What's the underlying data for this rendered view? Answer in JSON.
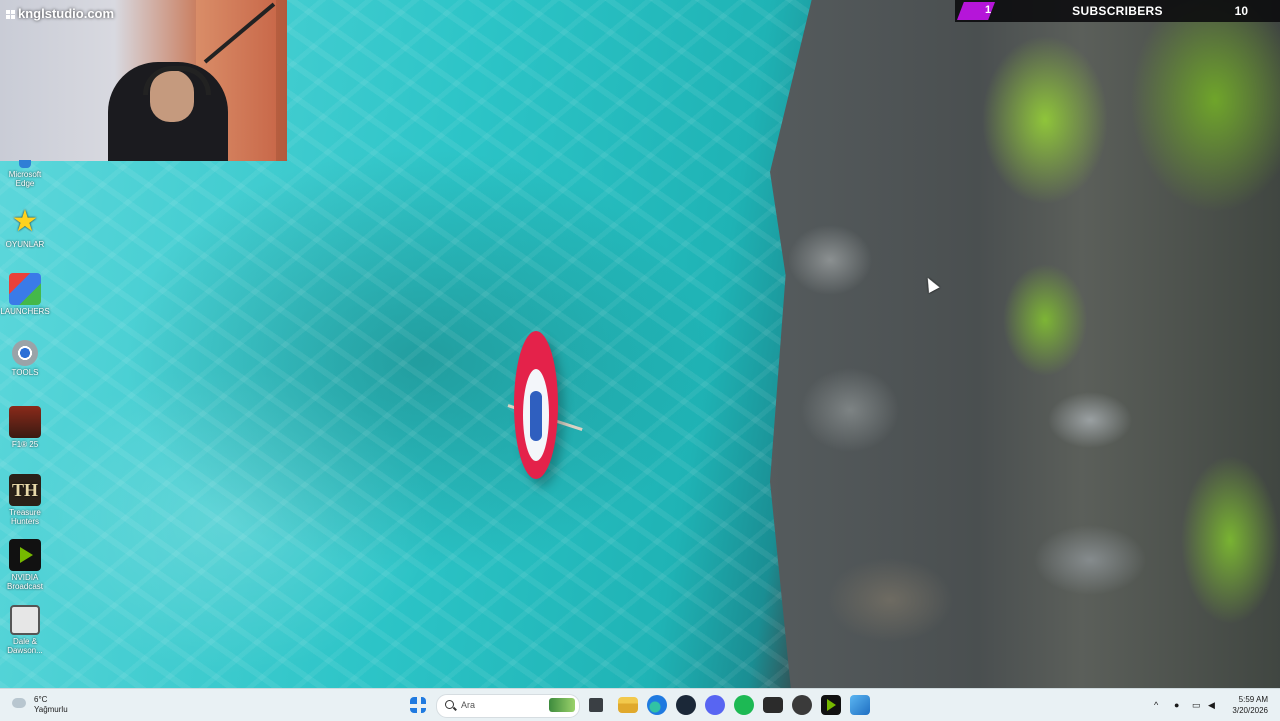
{
  "webcam": {
    "brand": "knglstudio.com"
  },
  "subscriber_goal": {
    "current": "1",
    "label": "SUBSCRIBERS",
    "target": "10",
    "progress_fraction": 0.1,
    "bar_color": "#b515d9"
  },
  "desktop_icons": [
    {
      "label": "Microsoft Edge",
      "icon": "edge-icon"
    },
    {
      "label": "OYUNLAR",
      "icon": "star-folder-icon"
    },
    {
      "label": "LAUNCHERS",
      "icon": "launchers-folder-icon"
    },
    {
      "label": "TOOLS",
      "icon": "tools-gear-icon"
    },
    {
      "label": "F1® 25",
      "icon": "f1-game-icon"
    },
    {
      "label": "Treasure Hunters",
      "icon": "treasure-hunters-icon"
    },
    {
      "label": "NVIDIA Broadcast",
      "icon": "nvidia-broadcast-icon"
    },
    {
      "label": "Dale & Dawson...",
      "icon": "dale-dawson-icon"
    }
  ],
  "taskbar": {
    "weather": {
      "temp": "6°C",
      "condition": "Yağmurlu",
      "icon": "rain-cloud-icon"
    },
    "search_placeholder": "Ara",
    "pinned": [
      {
        "name": "start",
        "icon": "windows-start-icon"
      },
      {
        "name": "task-view",
        "icon": "task-view-icon"
      },
      {
        "name": "file-explorer",
        "icon": "folder-icon"
      },
      {
        "name": "edge",
        "icon": "edge-icon"
      },
      {
        "name": "steam",
        "icon": "steam-icon"
      },
      {
        "name": "discord",
        "icon": "discord-icon"
      },
      {
        "name": "spotify",
        "icon": "spotify-icon"
      },
      {
        "name": "terminal",
        "icon": "terminal-icon"
      },
      {
        "name": "obs",
        "icon": "obs-icon"
      },
      {
        "name": "nvidia",
        "icon": "nvidia-icon"
      },
      {
        "name": "photos",
        "icon": "photos-icon"
      }
    ],
    "clock": {
      "time": "5:59 AM",
      "date": "3/20/2026"
    }
  }
}
